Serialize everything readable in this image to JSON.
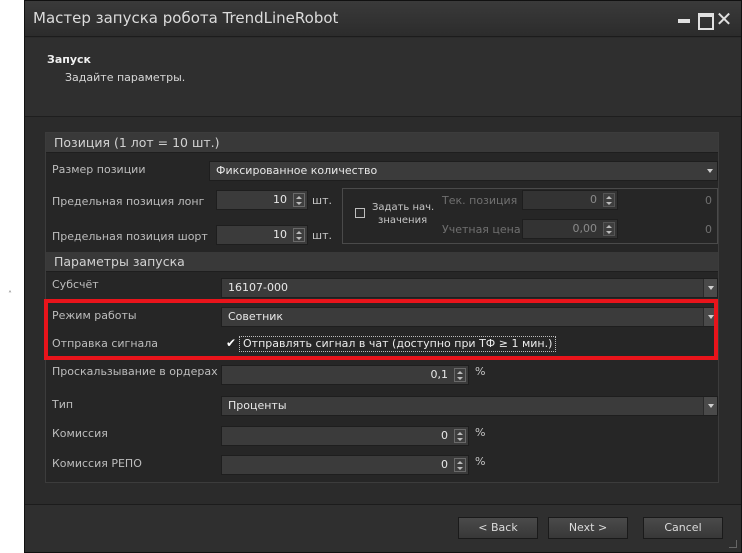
{
  "window": {
    "title": "Мастер запуска робота TrendLineRobot"
  },
  "header": {
    "title": "Запуск",
    "subtitle": "Задайте параметры."
  },
  "position_section": {
    "heading": "Позиция (1 лот = 10 шт.)",
    "size_label": "Размер позиции",
    "size_value": "Фиксированное количество",
    "long_label": "Предельная позиция лонг",
    "long_value": "10",
    "long_unit": "шт.",
    "short_label": "Предельная позиция шорт",
    "short_value": "10",
    "short_unit": "шт.",
    "set_initial_label_1": "Задать нач.",
    "set_initial_label_2": "значения",
    "current_position_label": "Тек. позиция",
    "current_position_value": "0",
    "current_position_right": "0",
    "accounting_price_label": "Учетная цена",
    "accounting_price_value": "0,00",
    "accounting_price_right": "0"
  },
  "launch_section": {
    "heading": "Параметры запуска",
    "subaccount_label": "Субсчёт",
    "subaccount_value": "16107-000",
    "mode_label": "Режим работы",
    "mode_value": "Советник",
    "signal_label": "Отправка сигнала",
    "signal_checkbox_text": "Отправлять сигнал в чат (доступно при ТФ ≥ 1 мин.)",
    "signal_checked": true,
    "slippage_label": "Проскальзывание в ордерах",
    "slippage_value": "0,1",
    "slippage_unit": "%",
    "type_label": "Тип",
    "type_value": "Проценты",
    "commission_label": "Комиссия",
    "commission_value": "0",
    "commission_unit": "%",
    "repo_commission_label": "Комиссия РЕПО",
    "repo_commission_value": "0",
    "repo_commission_unit": "%"
  },
  "footer": {
    "back_label": "< Back",
    "next_label": "Next >",
    "cancel_label": "Cancel"
  },
  "colors": {
    "highlight": "#e8141b",
    "background": "#2b2b2b"
  }
}
